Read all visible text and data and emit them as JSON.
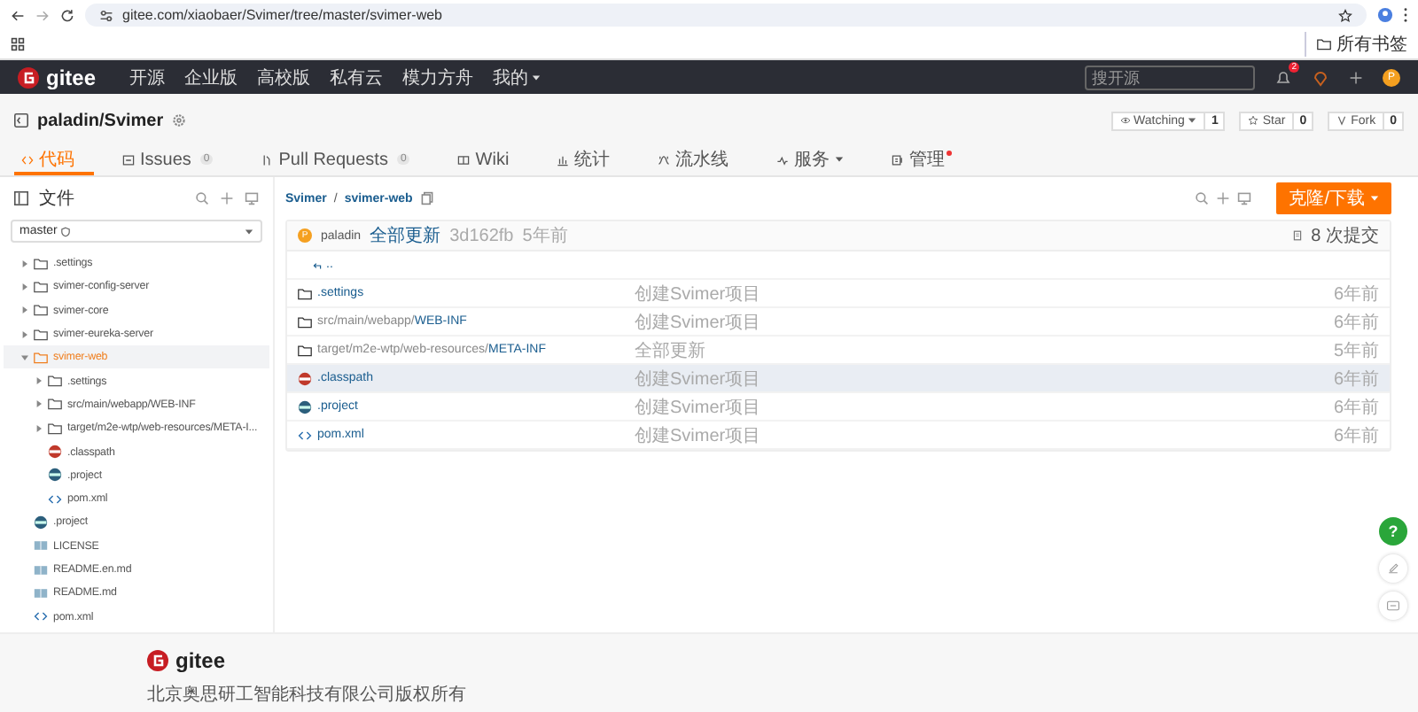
{
  "browser": {
    "url": "gitee.com/xiaobaer/Svimer/tree/master/svimer-web",
    "bookmarks": "所有书签"
  },
  "nav": {
    "logo": "gitee",
    "links": [
      "开源",
      "企业版",
      "高校版",
      "私有云",
      "模力方舟"
    ],
    "my_menu": "我的",
    "search_placeholder": "搜开源",
    "notification_count": "2",
    "avatar": "P"
  },
  "repo": {
    "name": "paladin/Svimer",
    "watch": {
      "label": "Watching",
      "count": "1"
    },
    "star": {
      "label": "Star",
      "count": "0"
    },
    "fork": {
      "label": "Fork",
      "count": "0"
    }
  },
  "tabs": [
    {
      "label": "代码",
      "selected": true
    },
    {
      "label": "Issues",
      "count": "0",
      "selected": false
    },
    {
      "label": "Pull Requests",
      "count": "0",
      "selected": false
    },
    {
      "label": "Wiki",
      "selected": false
    },
    {
      "label": "统计",
      "selected": false
    },
    {
      "label": "流水线",
      "selected": false
    },
    {
      "label": "服务",
      "selected": false,
      "has_menu": true
    },
    {
      "label": "管理",
      "selected": false,
      "has_dot": true
    }
  ],
  "sidebar": {
    "title": "文件",
    "branch": "master",
    "tree": [
      {
        "name": ".settings",
        "kind": "folder",
        "expanded": false,
        "selected": false
      },
      {
        "name": "svimer-config-server",
        "kind": "folder",
        "expanded": false,
        "selected": false
      },
      {
        "name": "svimer-core",
        "kind": "folder",
        "expanded": false,
        "selected": false
      },
      {
        "name": "svimer-eureka-server",
        "kind": "folder",
        "expanded": false,
        "selected": false
      },
      {
        "name": "svimer-web",
        "kind": "folder",
        "expanded": true,
        "selected": true,
        "children": [
          {
            "name": ".settings",
            "kind": "folder",
            "expanded": false,
            "selected": false
          },
          {
            "name": "src/main/webapp/WEB-INF",
            "kind": "folder",
            "expanded": false,
            "selected": false
          },
          {
            "name": "target/m2e-wtp/web-resources/META-I...",
            "kind": "folder",
            "expanded": false,
            "selected": false
          },
          {
            "name": ".classpath",
            "kind": "classpath",
            "selected": false
          },
          {
            "name": ".project",
            "kind": "project",
            "selected": false
          },
          {
            "name": "pom.xml",
            "kind": "code",
            "selected": false
          }
        ]
      },
      {
        "name": ".project",
        "kind": "project",
        "selected": false
      },
      {
        "name": "LICENSE",
        "kind": "doc",
        "selected": false
      },
      {
        "name": "README.en.md",
        "kind": "doc",
        "selected": false
      },
      {
        "name": "README.md",
        "kind": "doc",
        "selected": false
      },
      {
        "name": "pom.xml",
        "kind": "code",
        "selected": false
      }
    ]
  },
  "main": {
    "breadcrumb": [
      "Svimer",
      "/",
      "svimer-web"
    ],
    "clone_button": "克隆/下载",
    "commit": {
      "avatar": "P",
      "author": "paladin",
      "message": "全部更新",
      "hash": "3d162fb",
      "time": "5年前",
      "commits": "8 次提交"
    },
    "parent_link": "..",
    "files": [
      {
        "kind": "folder",
        "name": ".settings",
        "message": "创建Svimer项目",
        "time": "6年前",
        "selected": false
      },
      {
        "kind": "folder",
        "path": "src/main/webapp/",
        "name": "WEB-INF",
        "message": "创建Svimer项目",
        "time": "6年前",
        "selected": false
      },
      {
        "kind": "folder",
        "path": "target/m2e-wtp/web-resources/",
        "name": "META-INF",
        "message": "全部更新",
        "time": "5年前",
        "selected": false
      },
      {
        "kind": "classpath",
        "name": ".classpath",
        "message": "创建Svimer项目",
        "time": "6年前",
        "selected": true
      },
      {
        "kind": "project",
        "name": ".project",
        "message": "创建Svimer项目",
        "time": "6年前",
        "selected": false
      },
      {
        "kind": "code",
        "name": "pom.xml",
        "message": "创建Svimer项目",
        "time": "6年前",
        "selected": false
      }
    ]
  },
  "float_help": "?",
  "footer": {
    "logo": "gitee",
    "copyright": "北京奥思研工智能科技有限公司版权所有"
  }
}
